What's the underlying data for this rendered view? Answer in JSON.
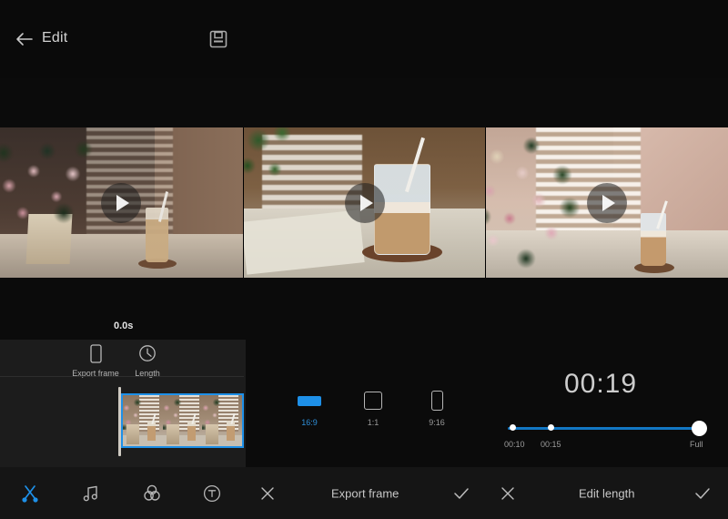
{
  "app": {
    "header": {
      "title": "Edit",
      "back_icon": "arrow-left-icon",
      "save_icon": "floppy-save-icon"
    },
    "previews": [
      {
        "play_icon": "play-icon",
        "alt": "roses vase and iced coffee on table"
      },
      {
        "play_icon": "play-icon",
        "alt": "close-up iced latte with straw"
      },
      {
        "play_icon": "play-icon",
        "alt": "floral arrangement with iced coffee"
      }
    ],
    "timeline": {
      "position_label": "0.0s",
      "playhead_icon": "playhead-handle"
    },
    "tools": [
      {
        "label": "Export frame",
        "icon": "phone-frame-icon",
        "selected": false
      },
      {
        "label": "Length",
        "icon": "clock-icon",
        "selected": false
      }
    ],
    "aspect_ratios": {
      "options": [
        {
          "label": "16:9",
          "icon": "rect-landscape-icon",
          "selected": true
        },
        {
          "label": "1:1",
          "icon": "square-icon",
          "selected": false
        },
        {
          "label": "9:16",
          "icon": "rect-portrait-icon",
          "selected": false
        }
      ]
    },
    "length": {
      "duration": "00:19",
      "ticks": [
        "00:10",
        "00:15",
        "Full"
      ],
      "selected_tick": "Full"
    },
    "bottombar": {
      "tools": [
        {
          "name": "trim",
          "icon": "scissors-icon",
          "active": true
        },
        {
          "name": "music",
          "icon": "music-note-icon",
          "active": false
        },
        {
          "name": "filter",
          "icon": "filter-circles-icon",
          "active": false
        },
        {
          "name": "text",
          "icon": "text-circle-icon",
          "active": false
        }
      ],
      "export_frame": {
        "cancel_icon": "close-icon",
        "label": "Export frame",
        "confirm_icon": "check-icon"
      },
      "edit_length": {
        "cancel_icon": "close-icon",
        "label": "Edit length",
        "confirm_icon": "check-icon"
      }
    },
    "colors": {
      "accent": "#1e90e8",
      "accent_dark": "#1277c4",
      "background": "#0b0b0b",
      "panel": "#1c1c1c",
      "bottombar": "#151515",
      "text": "#cfcfcf"
    }
  }
}
